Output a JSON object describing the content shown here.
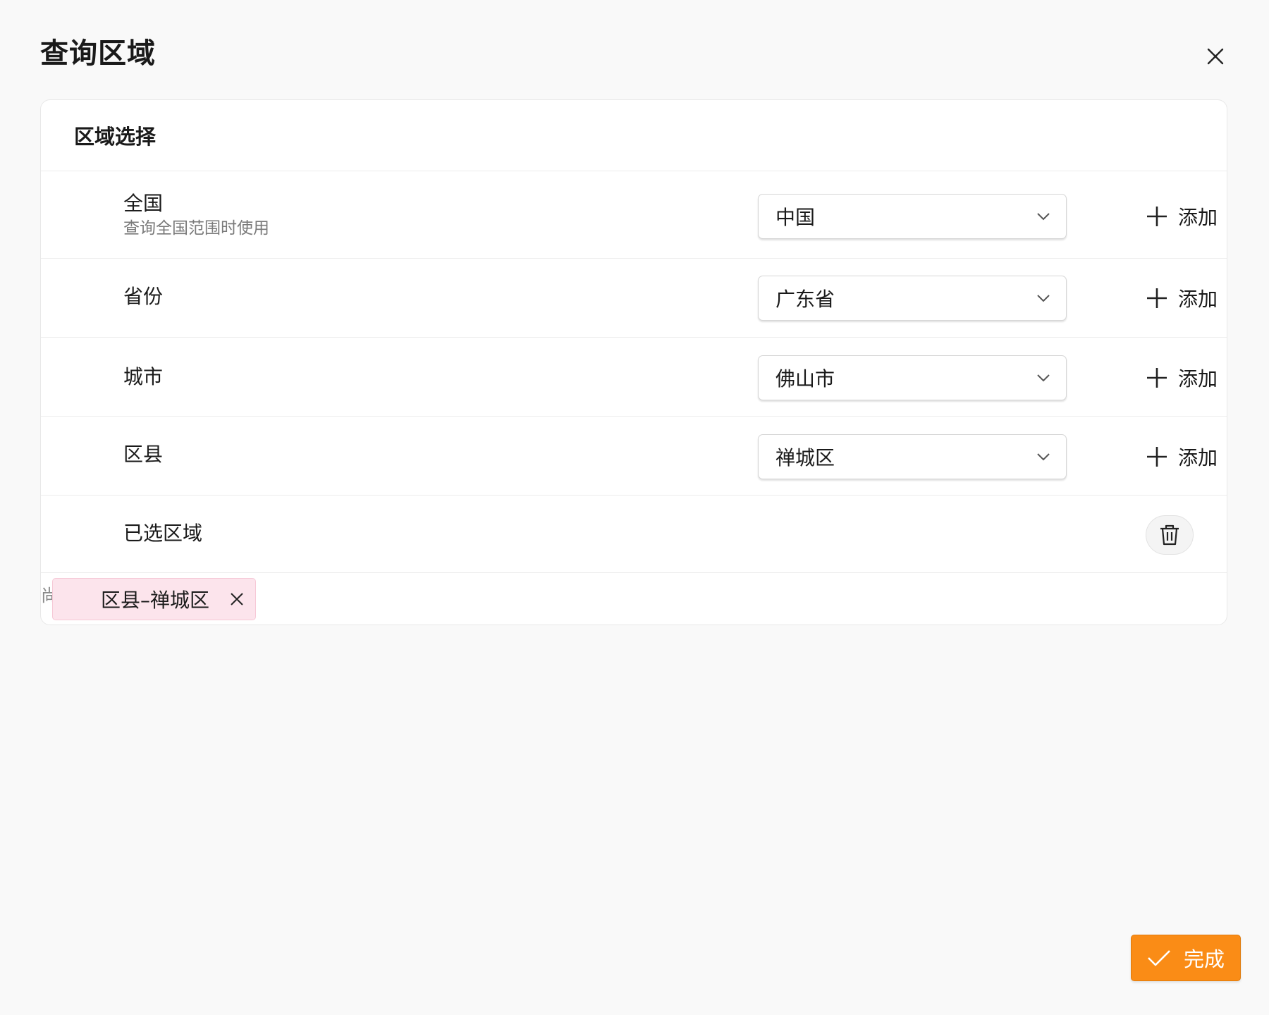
{
  "dialog": {
    "title": "查询区域"
  },
  "card": {
    "title": "区域选择"
  },
  "rows": [
    {
      "label": "全国",
      "sub": "查询全国范围时使用",
      "value": "中国",
      "add_label": "添加"
    },
    {
      "label": "省份",
      "value": "广东省",
      "add_label": "添加"
    },
    {
      "label": "城市",
      "value": "佛山市",
      "add_label": "添加"
    },
    {
      "label": "区县",
      "value": "禅城区",
      "add_label": "添加"
    }
  ],
  "selected": {
    "label": "已选区域",
    "hint": "尚",
    "chips": [
      {
        "label": "区县–禅城区"
      }
    ]
  },
  "footer": {
    "done_label": "完成"
  },
  "colors": {
    "accent": "#fa8c16",
    "chip_bg": "#fce4ec"
  },
  "icons": [
    "close-icon",
    "chevron-down-icon",
    "plus-icon",
    "trash-icon",
    "check-icon"
  ]
}
